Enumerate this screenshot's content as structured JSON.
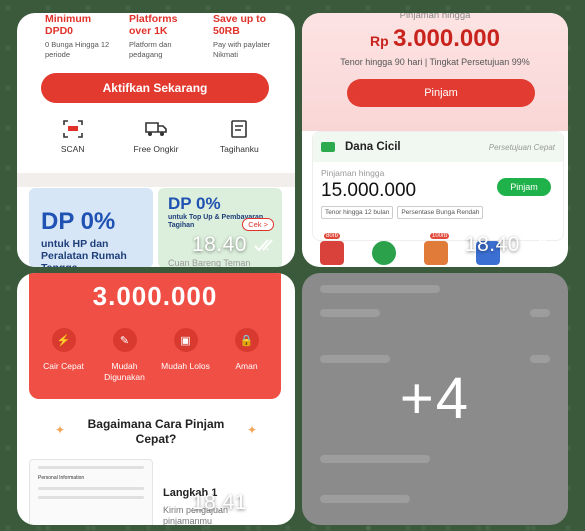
{
  "tiles": [
    {
      "promos": [
        {
          "title": "Minimum DPD0",
          "sub": "0 Bunga Hingga 12 periode"
        },
        {
          "title": "Platforms over 1K",
          "sub": "Platform dan pedagang"
        },
        {
          "title": "Save up to 50RB",
          "sub": "Pay with paylater Nikmati"
        }
      ],
      "cta": "Aktifkan Sekarang",
      "icons": [
        {
          "icon": "scan-icon",
          "label": "SCAN"
        },
        {
          "icon": "truck-icon",
          "label": "Free Ongkir"
        },
        {
          "icon": "bill-icon",
          "label": "Tagihanku"
        }
      ],
      "banner_left": {
        "big": "DP 0%",
        "small": "untuk HP dan Peralatan Rumah Tangga"
      },
      "banner_right": {
        "big": "DP 0%",
        "small": "untuk Top Up & Pembayaran Tagihan",
        "button": "Cek >",
        "bottom": "Cuan Bareng Teman"
      },
      "time": "18.40"
    },
    {
      "header": "Pinjaman hingga",
      "currency": "Rp",
      "amount": "3.000.000",
      "note": "Tenor hingga 90 hari | Tingkat Persetujuan 99%",
      "cta": "Pinjam",
      "card": {
        "name": "Dana Cicil",
        "tag": "Persetujuan Cepat",
        "label": "Pinjaman hingga",
        "amount": "15.000.000",
        "button": "Pinjam",
        "chips": [
          "Tenor hingga 12 bulan",
          "Persentase Bunga Rendah"
        ]
      },
      "badges": [
        "80rb",
        "100rb"
      ],
      "time": "18.40"
    },
    {
      "amount": "3.000.000",
      "features": [
        {
          "icon": "lightning-icon",
          "label": "Cair Cepat"
        },
        {
          "icon": "pen-icon",
          "label": "Mudah Digunakan"
        },
        {
          "icon": "briefcase-icon",
          "label": "Mudah Lolos"
        },
        {
          "icon": "lock-icon",
          "label": "Aman"
        }
      ],
      "title": "Bagaimana Cara Pinjam Cepat?",
      "step_title": "Langkah 1",
      "step_sub": "Kirim pengajuan pinjamanmu",
      "shot_label": "Personal Information",
      "time": "18.41"
    },
    {
      "overlay": "+4"
    }
  ],
  "colors": {
    "accent_red": "#e33a30",
    "green": "#1fb24a",
    "blue": "#1f52b3",
    "bg": "#3b5a3c"
  }
}
